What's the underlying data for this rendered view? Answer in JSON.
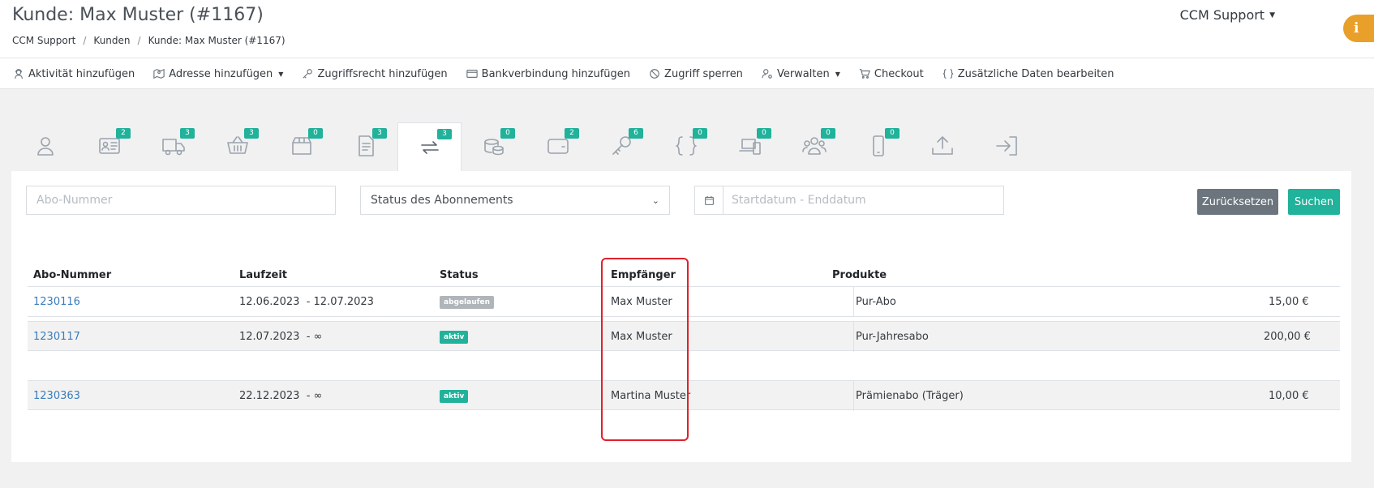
{
  "header": {
    "title": "Kunde: Max Muster (#1167)",
    "breadcrumb": [
      "CCM Support",
      "Kunden",
      "Kunde: Max Muster (#1167)"
    ],
    "user": "CCM Support",
    "info_badge": "i"
  },
  "toolbar": {
    "items": [
      {
        "label": "Aktivität hinzufügen",
        "icon": "user-headset-icon"
      },
      {
        "label": "Adresse hinzufügen",
        "icon": "map-icon",
        "dropdown": true
      },
      {
        "label": "Zugriffsrecht hinzufügen",
        "icon": "key-icon"
      },
      {
        "label": "Bankverbindung hinzufügen",
        "icon": "card-icon"
      },
      {
        "label": "Zugriff sperren",
        "icon": "ban-icon"
      },
      {
        "label": "Verwalten",
        "icon": "user-cog-icon",
        "dropdown": true
      },
      {
        "label": "Checkout",
        "icon": "cart-icon"
      },
      {
        "label": "Zusätzliche Daten bearbeiten",
        "icon": "braces-icon"
      }
    ]
  },
  "tabs": [
    {
      "icon": "user-icon",
      "badge": null
    },
    {
      "icon": "id-card-icon",
      "badge": "2"
    },
    {
      "icon": "truck-icon",
      "badge": "3"
    },
    {
      "icon": "basket-icon",
      "badge": "3"
    },
    {
      "icon": "box-icon",
      "badge": "0"
    },
    {
      "icon": "document-icon",
      "badge": "3"
    },
    {
      "icon": "subscription-icon",
      "badge": "3",
      "active": true
    },
    {
      "icon": "coins-icon",
      "badge": "0"
    },
    {
      "icon": "wallet-icon",
      "badge": "2"
    },
    {
      "icon": "key-icon",
      "badge": "6"
    },
    {
      "icon": "braces-icon",
      "badge": "0"
    },
    {
      "icon": "devices-icon",
      "badge": "0"
    },
    {
      "icon": "users-icon",
      "badge": "0"
    },
    {
      "icon": "mobile-icon",
      "badge": "0"
    },
    {
      "icon": "upload-icon",
      "badge": null
    },
    {
      "icon": "sign-in-icon",
      "badge": null
    }
  ],
  "filters": {
    "abo_placeholder": "Abo-Nummer",
    "status_value": "Status des Abonnements",
    "date_placeholder": "Startdatum - Enddatum",
    "reset_label": "Zurücksetzen",
    "search_label": "Suchen"
  },
  "table": {
    "columns": [
      "Abo-Nummer",
      "Laufzeit",
      "Status",
      "Empfänger",
      "Produkte"
    ],
    "rows": [
      {
        "abo": "1230116",
        "laufzeit": "12.06.2023  - 12.07.2023",
        "status": "abgelaufen",
        "status_type": "expired",
        "empfaenger": "Max Muster",
        "produkt": "Pur-Abo",
        "preis": "15,00 €"
      },
      {
        "abo": "1230117",
        "laufzeit": "12.07.2023  - ∞",
        "status": "aktiv",
        "status_type": "active",
        "empfaenger": "Max Muster",
        "produkt": "Pur-Jahresabo",
        "preis": "200,00 €"
      },
      {
        "abo": "1230363",
        "laufzeit": "22.12.2023  - ∞",
        "status": "aktiv",
        "status_type": "active",
        "empfaenger": "Martina Muster",
        "produkt": "Prämienabo (Träger)",
        "preis": "10,00 €"
      }
    ]
  },
  "colors": {
    "accent": "#20b29a",
    "link": "#3a7cba",
    "highlight": "#e0212b",
    "info": "#e8a02a"
  }
}
